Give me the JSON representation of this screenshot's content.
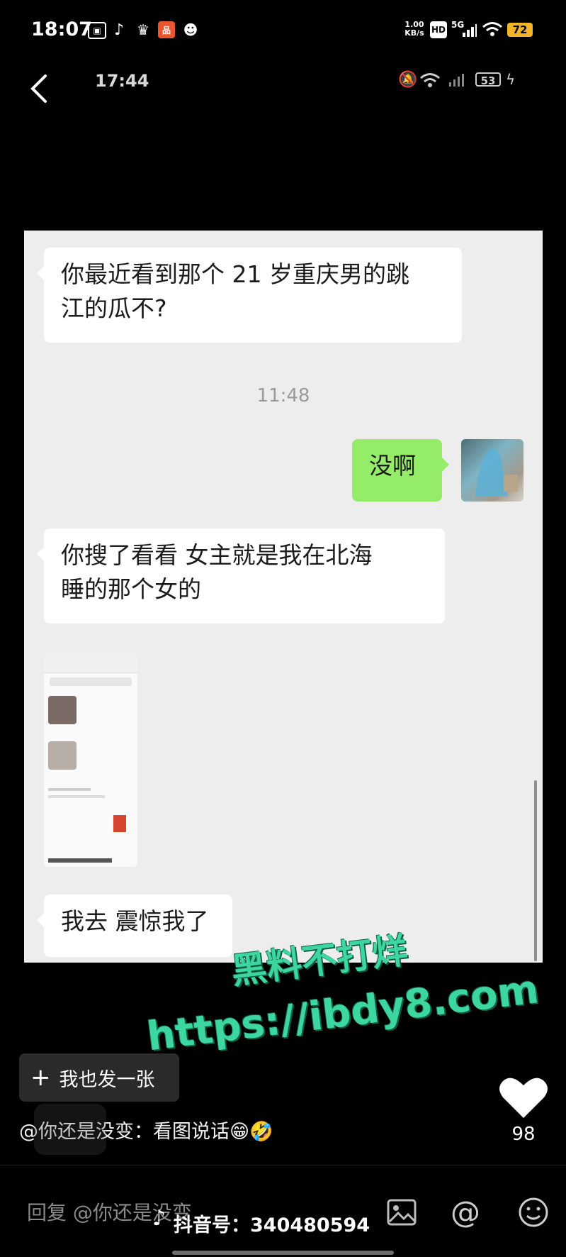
{
  "status_bar": {
    "time": "18:07",
    "net_speed": "1.00\nKB/s",
    "net_speed_top": "1.00",
    "net_speed_bottom": "KB/s",
    "hd": "HD",
    "signal": "5G",
    "battery": "72",
    "icons": [
      "calendar-icon",
      "douyin-icon",
      "crown-icon",
      "app-icon",
      "face-icon",
      "hd-icon",
      "signal-icon",
      "wifi-icon",
      "battery-icon"
    ]
  },
  "inner_status": {
    "time": "17:44",
    "battery": "53",
    "icons": [
      "back-icon",
      "mute-icon",
      "wifi-icon",
      "signal-icon",
      "battery-icon",
      "charging-icon"
    ]
  },
  "chat": {
    "messages": [
      {
        "side": "left",
        "text_line1": "你最近看到那个 21 岁重庆男的跳",
        "text_line2": "江的瓜不?"
      },
      {
        "side": "time",
        "text": "11:48"
      },
      {
        "side": "right",
        "text": "没啊"
      },
      {
        "side": "left",
        "text_line1": "你搜了看看   女主就是我在北海",
        "text_line2": "睡的那个女的"
      },
      {
        "side": "left-image",
        "text": ""
      },
      {
        "side": "left",
        "text": "我去   震惊我了"
      }
    ]
  },
  "watermark": {
    "line1": "黑料不打烊",
    "line2": "https://ibdy8.com"
  },
  "post_button": {
    "label": "我也发一张"
  },
  "caption": {
    "text": "@你还是没变：看图说话",
    "emojis": "😁🤣"
  },
  "like": {
    "count": "98"
  },
  "reply": {
    "placeholder": "回复 @你还是没变",
    "douyin_id": "抖音号：340480594"
  },
  "colors": {
    "bubble_green": "#95ec69",
    "chat_bg": "#ededed",
    "watermark": "#3ed6a0"
  }
}
